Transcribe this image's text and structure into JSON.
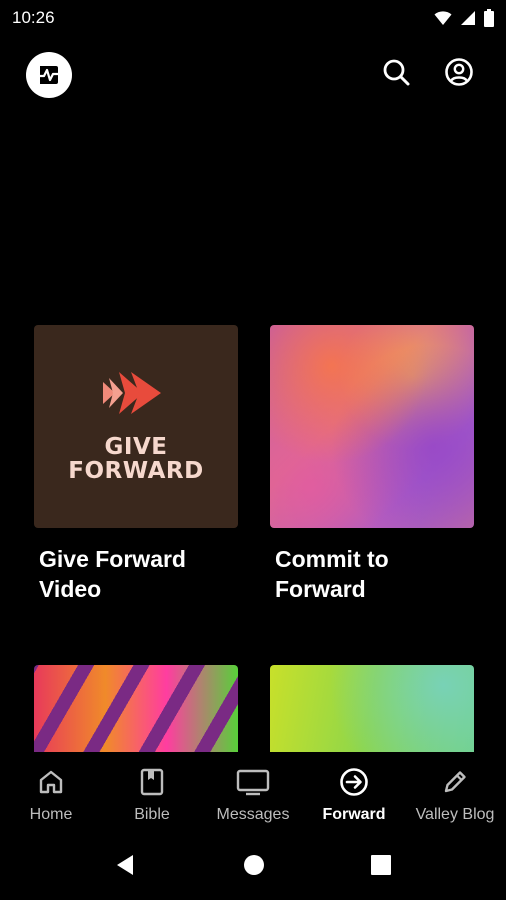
{
  "status_bar": {
    "time": "10:26",
    "icons": [
      "wifi-icon",
      "signal-icon",
      "battery-icon"
    ]
  },
  "app_bar": {
    "logo": "church-logo-icon",
    "search_icon": "search-icon",
    "account_icon": "account-circle-icon"
  },
  "cards": [
    {
      "title": "Give Forward Video",
      "thumb_text_line1": "GIVE",
      "thumb_text_line2": "FORWARD",
      "thumb_colors": [
        "#3a281d",
        "#e84b3c",
        "#f6d8cd"
      ]
    },
    {
      "title": "Commit to Forward",
      "thumb_colors": [
        "#c35aa8",
        "#d9708a",
        "#a45ec9"
      ]
    },
    {
      "title": "",
      "thumb_colors": [
        "#e83a5a",
        "#f08a2a",
        "#7a2a84"
      ]
    },
    {
      "title": "",
      "thumb_colors": [
        "#c8e02a",
        "#8ed64a",
        "#6bd08a"
      ]
    }
  ],
  "bottom_nav": {
    "items": [
      {
        "label": "Home",
        "icon": "home-icon",
        "active": false
      },
      {
        "label": "Bible",
        "icon": "book-icon",
        "active": false
      },
      {
        "label": "Messages",
        "icon": "tv-icon",
        "active": false
      },
      {
        "label": "Forward",
        "icon": "arrow-circle-right-icon",
        "active": true
      },
      {
        "label": "Valley Blog",
        "icon": "pencil-icon",
        "active": false
      }
    ]
  },
  "system_nav": {
    "buttons": [
      "back-icon",
      "home-circle-icon",
      "recents-icon"
    ]
  },
  "colors": {
    "background": "#000000",
    "text": "#ffffff",
    "inactive_nav": "#bdbdbd"
  }
}
